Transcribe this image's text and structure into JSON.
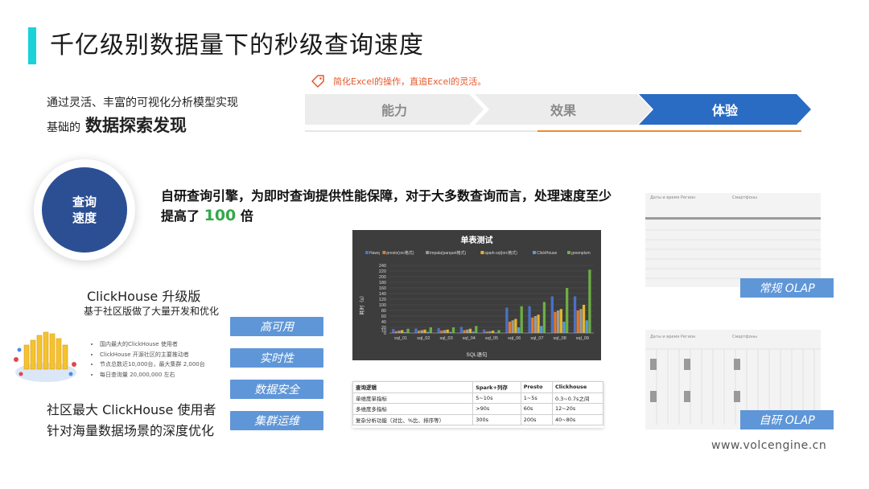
{
  "title": "千亿级别数据量下的秒级查询速度",
  "intro": {
    "line1": "通过灵活、丰富的可视化分析模型实现",
    "line2_prefix": "基础的",
    "line2_bold": "数据探索发现"
  },
  "tag": "简化Excel的操作，直追Excel的灵活。",
  "steps": [
    {
      "label": "能力"
    },
    {
      "label": "效果"
    },
    {
      "label": "体验"
    }
  ],
  "colors": {
    "accent": "#19d3d9",
    "step_active": "#2a6cc4",
    "orange": "#f08a2c",
    "feature": "#5f96d8",
    "circle": "#2c4f93",
    "highlight": "#35a84a"
  },
  "circle": {
    "line1": "查询",
    "line2": "速度"
  },
  "headline": {
    "text": "自研查询引擎，为即时查询提供性能保障，对于大多数查询而言，处理速度至少提高了",
    "highlight": "100",
    "suffix": "倍"
  },
  "clickhouse": {
    "title": "ClickHouse 升级版",
    "subtitle": "基于社区版做了大量开发和优化",
    "bullets": [
      "国内最大的ClickHouse 使用者",
      "ClickHouse 开源社区的主要推动者",
      "节点总数近10,000台，最大集群 2,000台",
      "每日查询量 20,000,000 左右"
    ],
    "footer1": "社区最大 ClickHouse 使用者",
    "footer2": "针对海量数据场景的深度优化"
  },
  "features": [
    "高可用",
    "实时性",
    "数据安全",
    "集群运维"
  ],
  "chart_data": {
    "type": "bar",
    "title": "单表测试",
    "xlabel": "SQL语句",
    "ylabel": "耗时（s）",
    "ylim": [
      0,
      240
    ],
    "yticks": [
      0,
      10,
      20,
      40,
      60,
      80,
      100,
      120,
      140,
      160,
      180,
      200,
      220,
      240
    ],
    "categories": [
      "sql_01",
      "sql_02",
      "sql_03",
      "sql_04",
      "sql_05",
      "sql_06",
      "sql_07",
      "sql_08",
      "sql_09"
    ],
    "series": [
      {
        "name": "Hawq",
        "color": "#4a72c4",
        "values": [
          14,
          16,
          17,
          22,
          12,
          90,
          95,
          130,
          130
        ]
      },
      {
        "name": "presto(orc格式)",
        "color": "#e07b30",
        "values": [
          6,
          8,
          8,
          10,
          5,
          40,
          55,
          75,
          80
        ]
      },
      {
        "name": "impala(parquet格式)",
        "color": "#9b9b9b",
        "values": [
          8,
          10,
          10,
          12,
          6,
          45,
          60,
          80,
          85
        ]
      },
      {
        "name": "spark-sql(orc格式)",
        "color": "#e3b52a",
        "values": [
          10,
          12,
          12,
          15,
          8,
          50,
          65,
          85,
          100
        ]
      },
      {
        "name": "ClickHouse",
        "color": "#5a9ad8",
        "values": [
          3,
          4,
          4,
          5,
          2,
          20,
          25,
          40,
          45
        ]
      },
      {
        "name": "greenplum",
        "color": "#6cae45",
        "values": [
          15,
          20,
          20,
          25,
          10,
          95,
          110,
          160,
          225
        ]
      }
    ]
  },
  "table": {
    "headers": [
      "查询逻辑",
      "Spark+列存",
      "Presto",
      "Clickhouse"
    ],
    "rows": [
      [
        "单维度单指标",
        "5~10s",
        "1~5s",
        "0.3~0.7s之间"
      ],
      [
        "多维度多指标",
        ">90s",
        "60s",
        "12~20s"
      ],
      [
        "复杂分析功能（对比、%比、排序等）",
        "300s",
        "200s",
        "40~80s"
      ]
    ]
  },
  "olap": {
    "panel_labels": [
      "Даты и время",
      "Регион",
      "Смартфоны"
    ],
    "normal_label": "常规 OLAP",
    "self_label": "自研 OLAP"
  },
  "footer_url": "www.volcengine.cn"
}
